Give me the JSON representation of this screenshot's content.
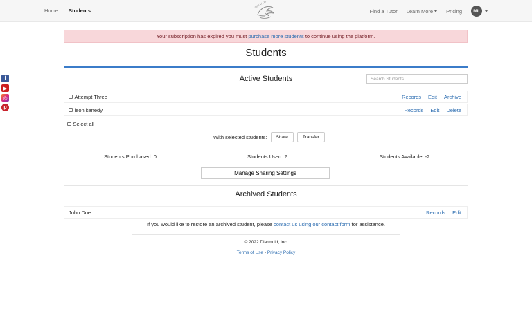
{
  "nav": {
    "home": "Home",
    "students": "Students",
    "find_tutor": "Find a Tutor",
    "learn_more": "Learn More",
    "pricing": "Pricing",
    "avatar_initials": "ML",
    "logo_text": "GREAT LEAPS"
  },
  "social": {
    "facebook": "f",
    "youtube": "▶",
    "instagram": "◎",
    "pinterest": "p"
  },
  "alert": {
    "before": "Your subscription has expired you must",
    "link": "purchase more students",
    "after": "to continue using the platform."
  },
  "page": {
    "title": "Students"
  },
  "active": {
    "title": "Active Students",
    "search_placeholder": "Search Students",
    "rows": [
      {
        "name": "Attempt Three",
        "records": "Records",
        "edit": "Edit",
        "third": "Archive"
      },
      {
        "name": "leon kenedy",
        "records": "Records",
        "edit": "Edit",
        "third": "Delete"
      }
    ],
    "select_all": "Select all",
    "with_selected": "With selected students:",
    "share": "Share",
    "transfer": "Transfer"
  },
  "stats": {
    "purchased": "Students Purchased: 0",
    "used": "Students Used: 2",
    "available": "Students Available: -2"
  },
  "manage_sharing": "Manage Sharing Settings",
  "archived": {
    "title": "Archived Students",
    "rows": [
      {
        "name": "John Doe",
        "records": "Records",
        "edit": "Edit"
      }
    ],
    "restore_before": "If you would like to restore an archived student, please",
    "restore_link": "contact us using our contact form",
    "restore_after": "for assistance."
  },
  "footer": {
    "copyright": "© 2022 Diarmuid, Inc.",
    "terms": "Terms of Use",
    "divider": "-",
    "privacy": "Privacy Policy"
  },
  "colors": {
    "accent": "#3b7cc9",
    "link": "#2b6cb0",
    "alert_bg": "#f8d7da",
    "alert_text": "#721c24"
  }
}
